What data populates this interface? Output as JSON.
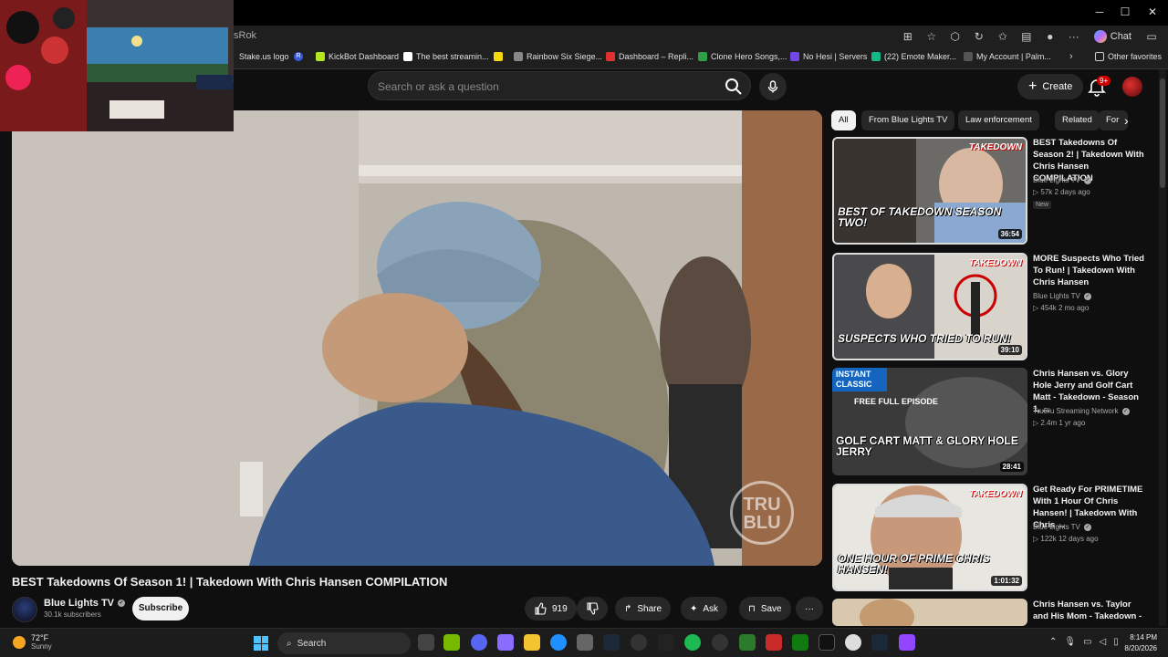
{
  "browser": {
    "address_text": "sRok",
    "chat_label": "Chat",
    "bookmarks": [
      {
        "label": "Stake.us logo"
      },
      {
        "label": "R"
      },
      {
        "label": "KickBot Dashboard"
      },
      {
        "label": "The best streamin..."
      },
      {
        "label": "Rainbow Six Siege..."
      },
      {
        "label": "Dashboard – Repli..."
      },
      {
        "label": "Clone Hero Songs,..."
      },
      {
        "label": "No Hesi | Servers"
      },
      {
        "label": "(22) Emote Maker..."
      },
      {
        "label": "My Account | Palm..."
      }
    ],
    "other_favorites": "Other favorites"
  },
  "header": {
    "search_placeholder": "Search or ask a question",
    "create_label": "Create",
    "notifications_badge": "9+"
  },
  "video": {
    "title": "BEST Takedowns Of Season 1! | Takedown With Chris Hansen COMPILATION",
    "channel": "Blue Lights TV",
    "subscribers": "30.1k subscribers",
    "subscribe_label": "Subscribe",
    "likes": "919",
    "share_label": "Share",
    "ask_label": "Ask",
    "save_label": "Save",
    "watermark": "TRU BLU"
  },
  "chips": [
    "All",
    "From Blue Lights TV",
    "Law enforcement",
    "Related",
    "For"
  ],
  "recommendations": [
    {
      "title": "BEST Takedowns Of Season 2! | Takedown With Chris Hansen COMPILATION",
      "channel": "Blue Lights TV",
      "meta": "57k  2 days ago",
      "badge": "New",
      "duration": "36:54",
      "caption": "BEST OF TAKEDOWN SEASON TWO!",
      "logo": "TAKEDOWN"
    },
    {
      "title": "MORE Suspects Who Tried To Run! | Takedown With Chris Hansen",
      "channel": "Blue Lights TV",
      "meta": "454k  2 mo ago",
      "duration": "39:10",
      "caption": "SUSPECTS WHO TRIED TO RUN!",
      "logo": "TAKEDOWN"
    },
    {
      "title": "Chris Hansen vs. Glory Hole Jerry and Golf Cart Matt - Takedown - Season 1, ...",
      "channel": "TruBlu Streaming Network",
      "meta": "2.4m  1 yr ago",
      "duration": "28:41",
      "caption": "GOLF CART MATT & GLORY HOLE JERRY",
      "tag": "INSTANT CLASSIC",
      "sub_tag": "FREE FULL EPISODE"
    },
    {
      "title": "Get Ready For PRIMETIME With 1 Hour Of Chris Hansen! | Takedown With Chris ...",
      "channel": "Blue Lights TV",
      "meta": "122k  12 days ago",
      "duration": "1:01:32",
      "caption": "ONE HOUR OF PRIME CHRIS HANSEN!",
      "logo": "TAKEDOWN"
    },
    {
      "title": "Chris Hansen vs. Taylor and His Mom - Takedown -"
    }
  ],
  "taskbar": {
    "temp": "72°F",
    "condition": "Sunny",
    "search_label": "Search",
    "time": "8:14 PM",
    "date": "8/20/2026"
  }
}
